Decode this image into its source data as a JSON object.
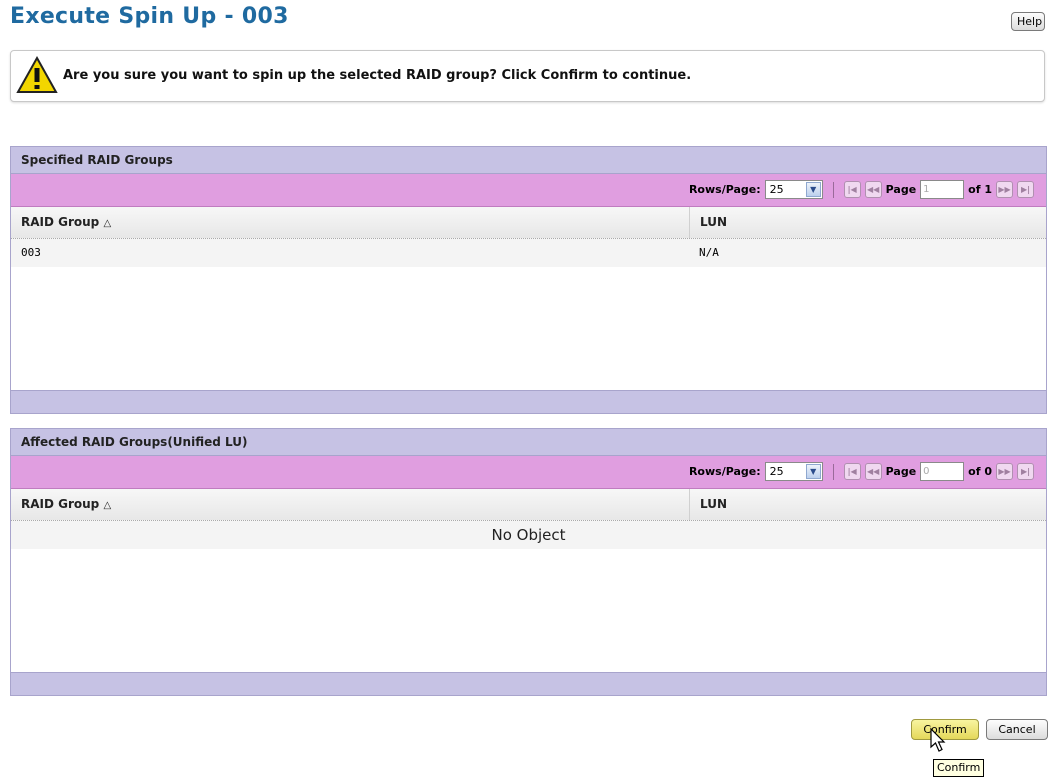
{
  "page": {
    "title": "Execute Spin Up - 003",
    "help_label": "Help"
  },
  "warning": {
    "icon": "warning-icon",
    "text": "Are you sure you want to spin up the selected RAID group? Click Confirm to continue."
  },
  "specified": {
    "header": "Specified RAID Groups",
    "rows_per_page_label": "Rows/Page:",
    "rows_per_page_value": "25",
    "page_label": "Page",
    "page_value": "1",
    "of_label": "of 1",
    "columns": [
      "RAID Group",
      "LUN"
    ],
    "rows": [
      {
        "raid_group": "003",
        "lun": "N/A"
      }
    ]
  },
  "affected": {
    "header": "Affected RAID Groups(Unified LU)",
    "rows_per_page_label": "Rows/Page:",
    "rows_per_page_value": "25",
    "page_label": "Page",
    "page_value": "0",
    "of_label": "of 0",
    "columns": [
      "RAID Group",
      "LUN"
    ],
    "empty_text": "No Object"
  },
  "actions": {
    "confirm_label": "Confirm",
    "cancel_label": "Cancel",
    "tooltip": "Confirm"
  },
  "colors": {
    "title": "#1f6aa0",
    "panel_header": "#c6c2e4",
    "toolbar": "#e09ee0",
    "confirm_bg": "#ece070"
  }
}
